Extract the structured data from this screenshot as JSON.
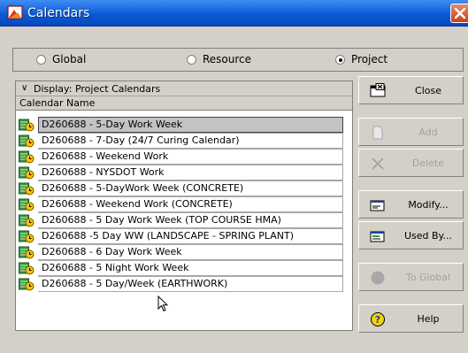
{
  "window": {
    "title": "Calendars"
  },
  "scope": {
    "options": [
      {
        "label": "Global",
        "selected": false
      },
      {
        "label": "Resource",
        "selected": false
      },
      {
        "label": "Project",
        "selected": true
      }
    ]
  },
  "list": {
    "display_label": "Display: Project Calendars",
    "column_header": "Calendar Name",
    "rows": [
      {
        "name": "D260688 - 5-Day Work Week",
        "selected": true
      },
      {
        "name": "D260688 - 7-Day (24/7 Curing Calendar)",
        "selected": false
      },
      {
        "name": "D260688 - Weekend Work",
        "selected": false
      },
      {
        "name": "D260688 - NYSDOT Work",
        "selected": false
      },
      {
        "name": "D260688 - 5-DayWork Week (CONCRETE)",
        "selected": false
      },
      {
        "name": "D260688 - Weekend Work (CONCRETE)",
        "selected": false
      },
      {
        "name": "D260688 - 5 Day Work Week (TOP COURSE HMA)",
        "selected": false
      },
      {
        "name": "D260688 -5 Day WW (LANDSCAPE - SPRING PLANT)",
        "selected": false
      },
      {
        "name": "D260688 - 6 Day Work Week",
        "selected": false
      },
      {
        "name": "D260688 - 5 Night Work Week",
        "selected": false
      },
      {
        "name": "D260688 - 5 Day/Week (EARTHWORK)",
        "selected": false
      }
    ]
  },
  "buttons": {
    "close": "Close",
    "add": "Add",
    "delete": "Delete",
    "modify": "Modify...",
    "used_by": "Used By...",
    "to_global": "To Global",
    "help": "Help"
  },
  "colors": {
    "title_bar": "#0a5bd8",
    "dialog_bg": "#d4d0c8",
    "selected_row": "#c3c3c3",
    "disabled_text": "#a0a0a0"
  },
  "icons": {
    "title": "calendar-app-icon",
    "row": "calendar-clock-icon",
    "close": "close-window-icon",
    "add": "blank-document-icon",
    "delete": "x-mark-icon",
    "modify": "edit-window-icon",
    "used_by": "window-list-icon",
    "to_global": "gray-circle-icon",
    "help": "question-mark-icon"
  }
}
